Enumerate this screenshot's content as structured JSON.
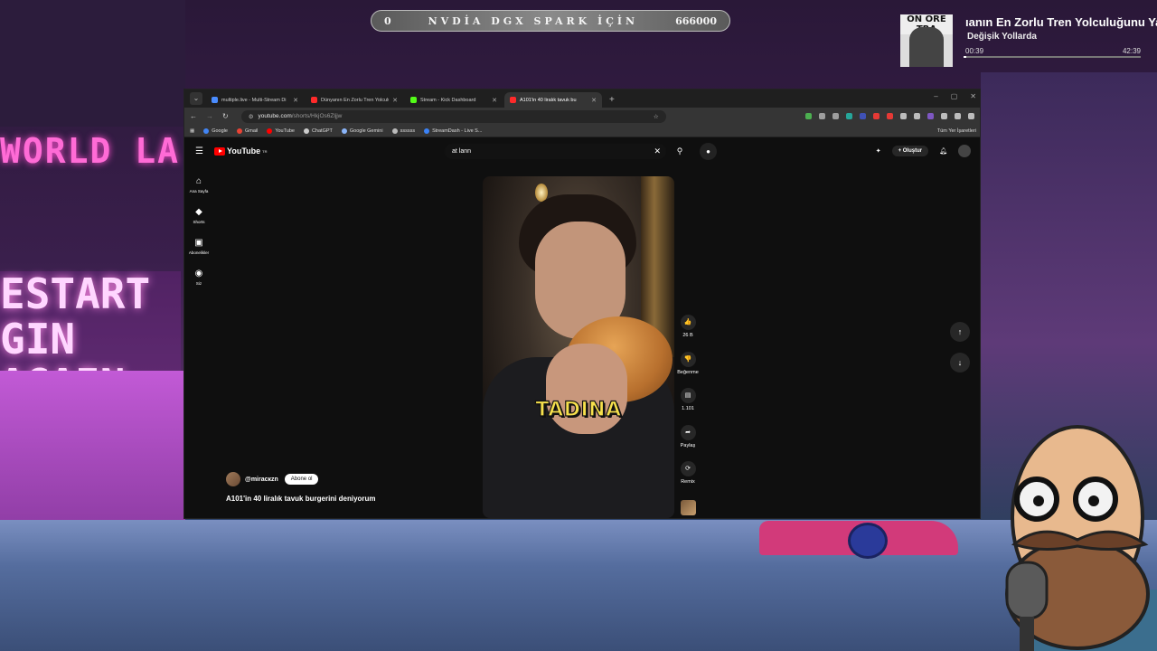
{
  "overlay": {
    "goal": {
      "left": "0",
      "title": "NVDİA DGX SPARK İÇİN",
      "right": "666000"
    },
    "now_playing": {
      "art_text": "ON ORE TRA",
      "title": "ıanın En Zorlu Tren Yolculuğunu Ya",
      "channel": "Değişik Yollarda",
      "current": "00:39",
      "total": "42:39",
      "progress": 0.015
    },
    "bg_neon": "WORLD LA",
    "bg_sign": [
      "ESTART",
      "GIN AGAIN"
    ]
  },
  "browser": {
    "tabs": [
      {
        "label": "multiple.live - Multi-Stream Di",
        "color": "#4a8cff"
      },
      {
        "label": "Dünyanın En Zorlu Tren Yolculu",
        "color": "#ff2a2a"
      },
      {
        "label": "Stream - Kick Dashboard",
        "color": "#53fc18"
      },
      {
        "label": "A101'in 40 liralık tavuk bu",
        "color": "#ff2a2a",
        "active": true
      }
    ],
    "url_host": "youtube.com",
    "url_path": "/shorts/HkjOs6Zljjw",
    "bookmarks": [
      {
        "label": "Google",
        "color": "#4285f4"
      },
      {
        "label": "Gmail",
        "color": "#ea4335"
      },
      {
        "label": "YouTube",
        "color": "#ff0000"
      },
      {
        "label": "ChatGPT",
        "color": "#cccccc"
      },
      {
        "label": "Google Gemini",
        "color": "#8ab4f8"
      },
      {
        "label": "ssssss",
        "color": "#bbbbbb"
      },
      {
        "label": "StreamDash - Live S...",
        "color": "#3b82f6"
      }
    ],
    "all_bookmarks": "Tüm Yer İşaretleri"
  },
  "youtube": {
    "logo": "YouTube",
    "logo_sup": "TR",
    "search_value": "at lann",
    "create_label": "Oluştur",
    "guide": [
      {
        "icon": "home-icon",
        "label": "Ana Sayfa",
        "glyph": "⌂"
      },
      {
        "icon": "shorts-icon",
        "label": "Shorts",
        "glyph": "◆"
      },
      {
        "icon": "subscriptions-icon",
        "label": "Abonelikler",
        "glyph": "▣"
      },
      {
        "icon": "you-icon",
        "label": "Siz",
        "glyph": "◉"
      }
    ],
    "caption": "TADINA",
    "actions": [
      {
        "name": "like",
        "glyph": "👍",
        "label": "26 B"
      },
      {
        "name": "dislike",
        "glyph": "👎",
        "label": "Beğenme"
      },
      {
        "name": "comments",
        "glyph": "▤",
        "label": "1.101"
      },
      {
        "name": "share",
        "glyph": "➦",
        "label": "Paylaş"
      },
      {
        "name": "remix",
        "glyph": "⟳",
        "label": "Remix"
      }
    ],
    "channel": "@miracкzn",
    "subscribe": "Abone ol",
    "title": "A101'in 40 liralık tavuk burgerini deniyorum"
  }
}
